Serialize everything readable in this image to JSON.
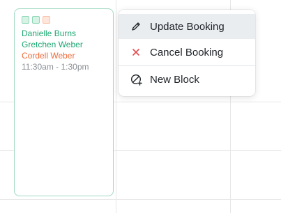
{
  "booking": {
    "names": [
      {
        "text": "Danielle Burns",
        "color": "#1ea672"
      },
      {
        "text": "Gretchen Weber",
        "color": "#1ea672"
      },
      {
        "text": "Cordell Weber",
        "color": "#ef6a3a"
      }
    ],
    "time": "11:30am - 1:30pm"
  },
  "context_menu": {
    "items": [
      {
        "label": "Update Booking",
        "icon": "pencil-icon"
      },
      {
        "label": "Cancel Booking",
        "icon": "close-icon",
        "icon_color": "#e5484d"
      },
      {
        "label": "New Block",
        "icon": "block-plus-icon"
      }
    ]
  }
}
